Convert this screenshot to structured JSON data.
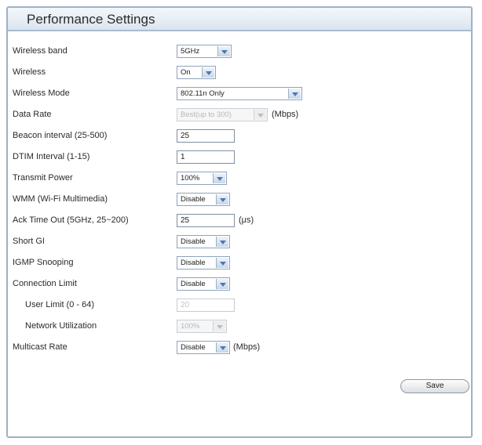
{
  "title": "Performance Settings",
  "settings": {
    "wireless_band": {
      "label": "Wireless band",
      "value": "5GHz"
    },
    "wireless": {
      "label": "Wireless",
      "value": "On"
    },
    "wireless_mode": {
      "label": "Wireless Mode",
      "value": "802.11n Only"
    },
    "data_rate": {
      "label": "Data Rate",
      "value": "Best(up to 300)",
      "unit": "(Mbps)"
    },
    "beacon_interval": {
      "label": "Beacon interval (25-500)",
      "value": "25"
    },
    "dtim_interval": {
      "label": "DTIM Interval (1-15)",
      "value": "1"
    },
    "transmit_power": {
      "label": "Transmit Power",
      "value": "100%"
    },
    "wmm": {
      "label": "WMM (Wi-Fi Multimedia)",
      "value": "Disable"
    },
    "ack_timeout": {
      "label": "Ack Time Out (5GHz, 25~200)",
      "value": "25",
      "unit": "(μs)"
    },
    "short_gi": {
      "label": "Short GI",
      "value": "Disable"
    },
    "igmp_snooping": {
      "label": "IGMP Snooping",
      "value": "Disable"
    },
    "connection_limit": {
      "label": "Connection Limit",
      "value": "Disable"
    },
    "user_limit": {
      "label": "User Limit (0 - 64)",
      "value": "20"
    },
    "network_utilization": {
      "label": "Network Utilization",
      "value": "100%"
    },
    "multicast_rate": {
      "label": "Multicast Rate",
      "value": "Disable",
      "unit": "(Mbps)"
    }
  },
  "save_label": "Save"
}
